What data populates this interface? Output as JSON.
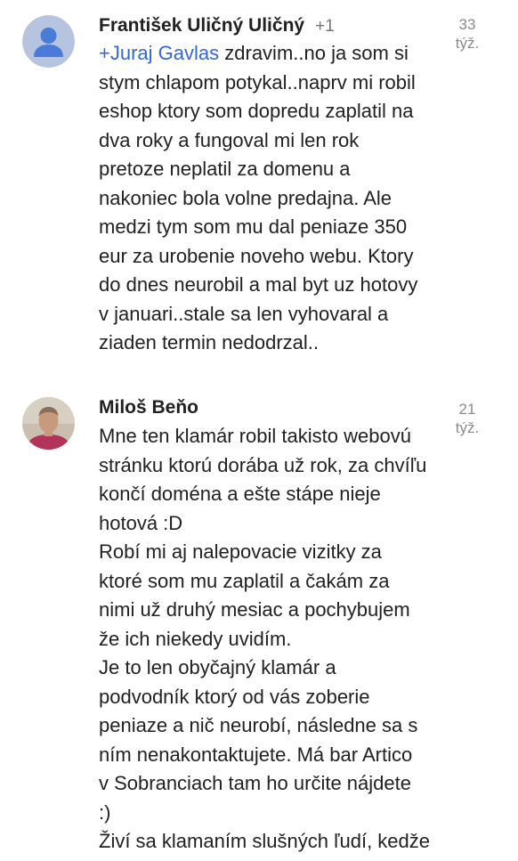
{
  "comments": [
    {
      "author": "František Uličný Uličný",
      "plus_one": "+1",
      "time_value": "33",
      "time_unit": "týž.",
      "mention_prefix": "+",
      "mention": "Juraj Gavlas",
      "lines": [
        " zdravim..no ja som si",
        "stym chlapom potykal..naprv mi robil",
        "eshop ktory som dopredu zaplatil na",
        "dva roky a fungoval mi len rok",
        "pretoze neplatil za domenu a",
        "nakoniec bola volne predajna. Ale",
        "medzi tym som mu dal peniaze 350",
        "eur za urobenie noveho webu. Ktory",
        "do dnes neurobil a mal byt uz hotovy",
        "v januari..stale sa len vyhovaral a",
        "ziaden termin nedodrzal.."
      ]
    },
    {
      "author": "Miloš Beňo",
      "time_value": "21",
      "time_unit": "týž.",
      "lines": [
        "Mne ten klamár robil takisto webovú",
        "stránku ktorú dorába už rok, za chvíľu",
        "končí doména a ešte stápe nieje",
        "hotová :D",
        "Robí mi aj nalepovacie vizitky za",
        "ktoré som mu zaplatil a čakám za",
        "nimi už druhý mesiac a pochybujem",
        "že ich niekedy uvidím.",
        "Je to len obyčajný klamár a",
        "podvodník ktorý od vás zoberie",
        "peniaze a nič neurobí, následne sa s",
        "ním nenakontaktujete. Má bar Artico",
        "v Sobranciach tam ho určite nájdete",
        ":)",
        "Živí sa klamaním slušných ľudí, kedže"
      ]
    }
  ]
}
